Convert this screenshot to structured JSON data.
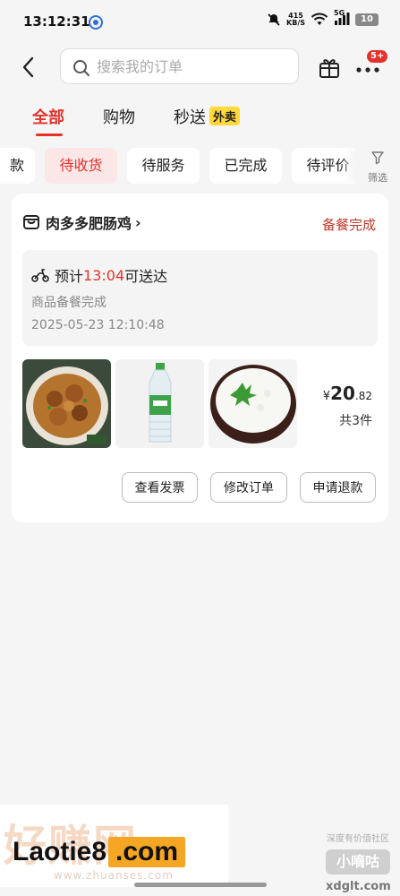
{
  "status_bar": {
    "time": "13:12:31",
    "net_speed_value": "415",
    "net_speed_unit": "KB/S",
    "network": "5G",
    "battery": "10"
  },
  "header": {
    "search_placeholder": "搜索我的订单",
    "badge": "5+"
  },
  "tabs": [
    {
      "label": "全部",
      "active": true
    },
    {
      "label": "购物",
      "active": false
    },
    {
      "label": "秒送",
      "active": false,
      "tag": "外卖"
    }
  ],
  "chips": [
    {
      "label": "款",
      "active": false
    },
    {
      "label": "待收货",
      "active": true
    },
    {
      "label": "待服务",
      "active": false
    },
    {
      "label": "已完成",
      "active": false
    },
    {
      "label": "待评价",
      "active": false
    }
  ],
  "filter_label": "筛选",
  "order": {
    "shop_name": "肉多多肥肠鸡",
    "chevron": "›",
    "status": "备餐完成",
    "eta_prefix": "预计",
    "eta_time": "13:04",
    "eta_suffix": "可送达",
    "progress_text": "商品备餐完成",
    "timestamp": "2025-05-23 12:10:48",
    "items": [
      "braised-chicken-image",
      "water-bottle-image",
      "rice-bowl-image"
    ],
    "currency": "¥",
    "price_int": "20",
    "price_dec": ".82",
    "count": "共3件",
    "actions": [
      "查看发票",
      "修改订单",
      "申请退款"
    ]
  },
  "watermark": {
    "bg_text": "好赚网",
    "main_text": "Laotie8",
    "com_text": ".com",
    "sub_text": "www.zhuanses.com",
    "right_top": "深度有价值社区",
    "right_logo": "小嘀咕",
    "right_url": "xdglt.com"
  },
  "colors": {
    "accent": "#e5312b",
    "chip_active_bg": "#fde6e6",
    "waimai_tag": "#ffd83a",
    "page_bg": "#f5f5f5"
  }
}
